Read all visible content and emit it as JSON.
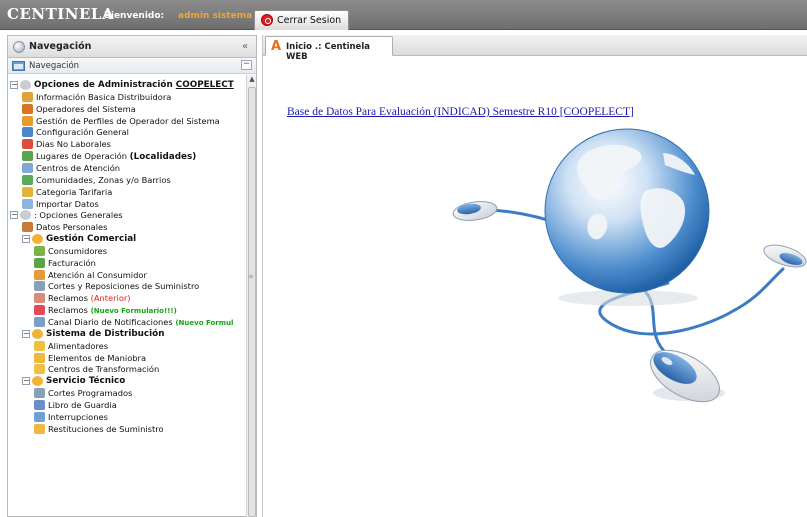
{
  "header": {
    "app_name": "CENTINELA",
    "welcome_label": "Bienvenido:",
    "username": "admin sistema",
    "logout_label": "Cerrar Sesion"
  },
  "sidebar": {
    "title": "Navegación",
    "collapse_glyph": "«",
    "accordion_title": "Navegación",
    "accordion_toggle": "−"
  },
  "tree": [
    {
      "label": "Opciones de Administración ",
      "suffix": "COOPELECT",
      "depth": 0,
      "kind": "group-bold",
      "icon": "folder-globe-icon"
    },
    {
      "label": "Información Basica Distribuidora",
      "depth": 1,
      "icon": "house-icon"
    },
    {
      "label": "Operadores del Sistema",
      "depth": 1,
      "icon": "users-icon"
    },
    {
      "label": "Gestión de Perfiles de Operador del Sistema",
      "depth": 1,
      "icon": "profile-icon"
    },
    {
      "label": "Configuración General",
      "depth": 1,
      "icon": "config-icon"
    },
    {
      "label": "Dias No Laborales",
      "depth": 1,
      "icon": "calendar-icon"
    },
    {
      "label": "Lugares de Operación ",
      "suffix": "(Localidades)",
      "depth": 1,
      "icon": "map-icon"
    },
    {
      "label": "Centros de Atención",
      "depth": 1,
      "icon": "building-icon"
    },
    {
      "label": "Comunidades, Zonas y/o Barrios",
      "depth": 1,
      "icon": "zone-icon"
    },
    {
      "label": "Categoria Tarifaria",
      "depth": 1,
      "icon": "tariff-icon"
    },
    {
      "label": "Importar Datos",
      "depth": 1,
      "icon": "import-icon"
    },
    {
      "label": ": Opciones Generales",
      "depth": 0,
      "kind": "group",
      "icon": "folder-globe-icon"
    },
    {
      "label": "Datos Personales",
      "depth": 1,
      "icon": "person-icon"
    },
    {
      "label": "Gestión Comercial",
      "depth": 1,
      "kind": "group-bold",
      "icon": "folder-icon"
    },
    {
      "label": "Consumidores",
      "depth": 2,
      "icon": "consumers-icon"
    },
    {
      "label": "Facturación",
      "depth": 2,
      "icon": "billing-icon"
    },
    {
      "label": "Atención al Consumidor",
      "depth": 2,
      "icon": "service-icon"
    },
    {
      "label": "Cortes y Reposiciones de Suministro",
      "depth": 2,
      "icon": "plug-icon"
    },
    {
      "label": "Reclamos ",
      "suffix": "(Anterior)",
      "suffix_style": "red",
      "depth": 2,
      "icon": "claims-icon"
    },
    {
      "label": "Reclamos ",
      "suffix": "(Nuevo Formulario!!!)",
      "suffix_style": "green",
      "depth": 2,
      "icon": "claims-new-icon"
    },
    {
      "label": "Canal Diario de Notificaciones ",
      "suffix": "(Nuevo Formul",
      "suffix_style": "green",
      "depth": 2,
      "icon": "notifications-icon"
    },
    {
      "label": "Sistema de Distribución",
      "depth": 1,
      "kind": "group-bold",
      "icon": "folder-icon"
    },
    {
      "label": "Alimentadores",
      "depth": 2,
      "icon": "feeder-icon"
    },
    {
      "label": "Elementos de Maniobra",
      "depth": 2,
      "icon": "switch-icon"
    },
    {
      "label": "Centros de Transformación",
      "depth": 2,
      "icon": "transformer-icon"
    },
    {
      "label": "Servicio Técnico",
      "depth": 1,
      "kind": "group-bold",
      "icon": "folder-icon"
    },
    {
      "label": "Cortes Programados",
      "depth": 2,
      "icon": "scheduled-cut-icon"
    },
    {
      "label": "Libro de Guardia",
      "depth": 2,
      "icon": "book-icon"
    },
    {
      "label": "Interrupciones",
      "depth": 2,
      "icon": "interruption-icon"
    },
    {
      "label": "Restituciones de Suministro",
      "depth": 2,
      "icon": "restore-icon"
    }
  ],
  "tabs": [
    {
      "label": "Inicio .: Centinela WEB",
      "icon": "home-a-icon"
    }
  ],
  "main": {
    "link_text": "Base de Datos Para Evaluación (INDICAD) Semestre R10 [COOPELECT]"
  },
  "colors": {
    "topbar": "#7a7a7a",
    "username": "#f5a623",
    "link": "#1a1ab0",
    "red_suffix": "#e02020",
    "green_suffix": "#16a416"
  }
}
